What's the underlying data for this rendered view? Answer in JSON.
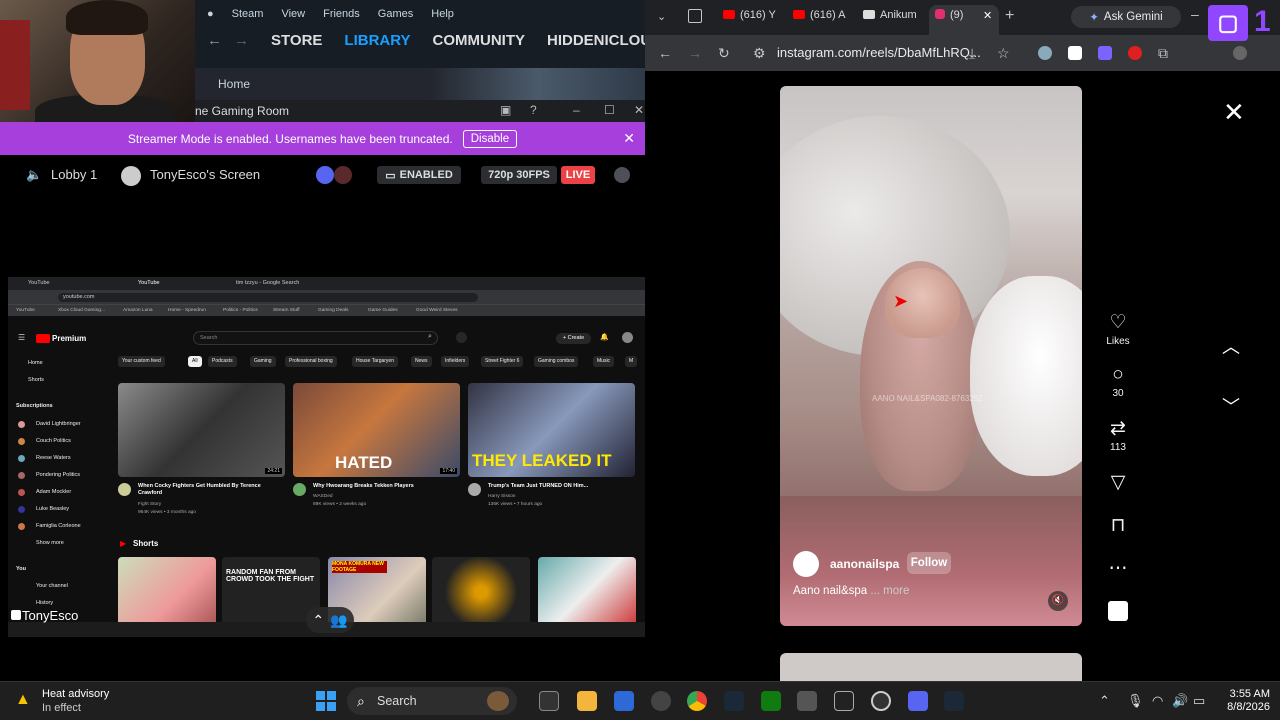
{
  "steam": {
    "menu": [
      "Steam",
      "View",
      "Friends",
      "Games",
      "Help"
    ],
    "nav": [
      "STORE",
      "LIBRARY",
      "COMMUNITY",
      "HIDDENICLOUD"
    ],
    "home": "Home"
  },
  "discord": {
    "window_title": "ne Gaming Room",
    "streamer_banner": "Streamer Mode is enabled. Usernames have been truncated.",
    "disable_label": "Disable",
    "lobby": "Lobby 1",
    "screen_label": "TonyEsco's Screen",
    "enabled_badge": "ENABLED",
    "quality_badge": "720p 30FPS",
    "live_badge": "LIVE",
    "streamer_name": "TonyEsco"
  },
  "shared_screen": {
    "tabs": [
      "YouTube",
      "YouTube",
      "tim tzzyu - Google Search"
    ],
    "url": "youtube.com",
    "bookmarks": [
      "YouTube",
      "Xbox Cloud Gaming...",
      "Amazon Luna",
      "Home - Speedrun",
      "Politics - Politics",
      "Stream Stuff",
      "Gaming Deals",
      "Game Guides",
      "Good Weird Steves"
    ],
    "logo": "Premium",
    "search_placeholder": "Search",
    "create_label": "+ Create",
    "sidebar": {
      "home": "Home",
      "shorts": "Shorts",
      "subscriptions": "Subscriptions",
      "subs": [
        "David Lightbringer",
        "Couch Politics",
        "Reese Waters",
        "Pondering Politics",
        "Adam Mockler",
        "Luke Beasley",
        "Famiglia Corleone"
      ],
      "show_more": "Show more",
      "you": "You",
      "your_channel": "Your channel",
      "history": "History"
    },
    "chips": [
      "Your custom feed",
      "All",
      "Podcasts",
      "Gaming",
      "Professional boxing",
      "House Targaryen",
      "News",
      "Infielders",
      "Street Fighter 6",
      "Gaming combos",
      "Music",
      "M"
    ],
    "videos": [
      {
        "title": "When Cocky Fighters Get Humbled By Terence Crawford",
        "channel": "Fight Story",
        "meta": "964K views • 3 months ago",
        "duration": "24:21",
        "overlay": ""
      },
      {
        "title": "Why Hwoarang Breaks Tekken Players",
        "channel": "WASDed",
        "meta": "89K views • 2 weeks ago",
        "duration": "17:40",
        "overlay": "HATED"
      },
      {
        "title": "Trump's Team Just TURNED ON Him...",
        "channel": "Harry Sisson",
        "meta": "136K views • 7 hours ago",
        "duration": "",
        "overlay": "THEY LEAKED IT"
      }
    ],
    "shorts_heading": "Shorts",
    "short_texts": [
      "",
      "RANDOM FAN FROM CROWD TOOK THE FIGHT",
      "MONA KOMURA NEW FOOTAGE",
      "",
      ""
    ]
  },
  "chrome": {
    "tabs": [
      "(616) Y",
      "(616) A",
      "Anikum",
      "(9)"
    ],
    "gemini": "Ask Gemini",
    "url": "instagram.com/reels/DbaMfLhRQ..."
  },
  "instagram": {
    "username": "aanonailspa",
    "follow": "Follow",
    "caption": "Aano nail&spa",
    "more": "... more",
    "watermark": "AANO NAIL&SPA082-8763252",
    "likes_label": "Likes",
    "comments": "30",
    "reposts": "113"
  },
  "twitch": {
    "count": "1"
  },
  "taskbar": {
    "weather_title": "Heat advisory",
    "weather_sub": "In effect",
    "search": "Search",
    "time": "3:55 AM",
    "date": "8/8/2026"
  },
  "colors": {
    "streamer_purple": "#a63fdc",
    "steam_blue": "#1a9fff",
    "live_red": "#ed4245",
    "twitch_purple": "#9146ff",
    "youtube_red": "#ff0000"
  }
}
